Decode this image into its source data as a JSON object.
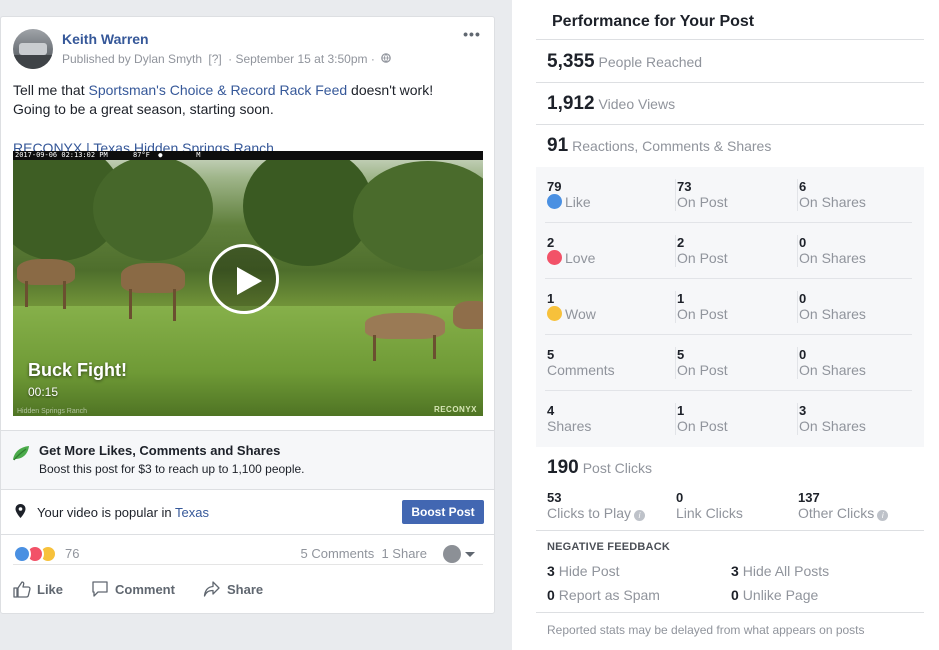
{
  "post": {
    "author": "Keith Warren",
    "published_by": "Published by Dylan Smyth",
    "help_marker": "[?]",
    "timestamp": "· September 15 at 3:50pm ·",
    "text_pre": "Tell me that ",
    "text_link": "Sportsman's Choice & Record Rack Feed",
    "text_post_1": " doesn't work!",
    "text_line2": "Going to be a great season, starting soon.",
    "link_line": "RECONYX | Texas Hidden Springs Ranch",
    "video": {
      "stamp": "2017-09-06 02:13:02 PM      87°F  ●        M",
      "title": "Buck Fight!",
      "duration": "00:15",
      "watermark": "RECONYX",
      "footer_text": "Hidden Springs Ranch"
    },
    "promo": {
      "title": "Get More Likes, Comments and Shares",
      "subtitle": "Boost this post for $3 to reach up to 1,100 people."
    },
    "popular": {
      "text_pre": "Your video is popular in ",
      "place": "Texas",
      "boost_button": "Boost Post"
    },
    "reactions": {
      "count": "76",
      "comments": "5 Comments",
      "shares": "1 Share"
    },
    "actions": {
      "like": "Like",
      "comment": "Comment",
      "share": "Share"
    }
  },
  "performance": {
    "title": "Performance for Your Post",
    "people_reached": {
      "num": "5,355",
      "label": "People Reached"
    },
    "video_views": {
      "num": "1,912",
      "label": "Video Views"
    },
    "engagement": {
      "num": "91",
      "label": "Reactions, Comments & Shares"
    },
    "rows": [
      {
        "c1v": "79",
        "c1l": "Like",
        "c2v": "73",
        "c2l": "On Post",
        "c3v": "6",
        "c3l": "On Shares"
      },
      {
        "c1v": "2",
        "c1l": "Love",
        "c2v": "2",
        "c2l": "On Post",
        "c3v": "0",
        "c3l": "On Shares"
      },
      {
        "c1v": "1",
        "c1l": "Wow",
        "c2v": "1",
        "c2l": "On Post",
        "c3v": "0",
        "c3l": "On Shares"
      },
      {
        "c1v": "5",
        "c1l": "Comments",
        "c2v": "5",
        "c2l": "On Post",
        "c3v": "0",
        "c3l": "On Shares"
      },
      {
        "c1v": "4",
        "c1l": "Shares",
        "c2v": "1",
        "c2l": "On Post",
        "c3v": "3",
        "c3l": "On Shares"
      }
    ],
    "post_clicks": {
      "num": "190",
      "label": "Post Clicks"
    },
    "clicks": [
      {
        "v": "53",
        "l": "Clicks to Play"
      },
      {
        "v": "0",
        "l": "Link Clicks"
      },
      {
        "v": "137",
        "l": "Other Clicks"
      }
    ],
    "negative": {
      "title": "NEGATIVE FEEDBACK",
      "hide_post": {
        "num": "3",
        "label": "Hide Post"
      },
      "hide_all": {
        "num": "3",
        "label": "Hide All Posts"
      },
      "spam": {
        "num": "0",
        "label": "Report as Spam"
      },
      "unlike": {
        "num": "0",
        "label": "Unlike Page"
      }
    },
    "footnote": "Reported stats may be delayed from what appears on posts"
  },
  "colors": {
    "link": "#365899",
    "boost": "#4267b2",
    "like": "#4a90e2",
    "love": "#f25268",
    "wow": "#f7c13b"
  }
}
